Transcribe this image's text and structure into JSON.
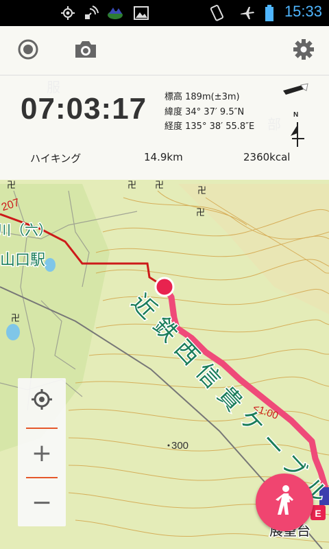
{
  "status_bar": {
    "time": "15:33",
    "icons": [
      "gps-icon",
      "satellite-icon",
      "app-icon",
      "image-icon",
      "vibrate-icon",
      "airplane-icon",
      "battery-icon"
    ]
  },
  "toolbar": {
    "record_icon": "record-icon",
    "camera_icon": "camera-icon",
    "settings_icon": "gear-icon"
  },
  "tracking": {
    "elapsed": "07:03:17",
    "elevation": "標高 189m(±3m)",
    "latitude": "緯度 34° 37′ 9.5″N",
    "longitude": "経度 135° 38′ 55.8″E",
    "compass_label": "N",
    "activity": "ハイキング",
    "distance": "14.9km",
    "calories": "2360kcal"
  },
  "map": {
    "labels": {
      "station": "山口駅",
      "railway": "近鉄西信貴ケーブル",
      "elevation_mark": "300",
      "time_marker": "<1:00",
      "viewpoint": "展望台",
      "road": "207",
      "kanji_top": "服",
      "kanji_right": "部",
      "paren": "川（六）"
    },
    "colors": {
      "track": "#ef4a79",
      "past_route": "#cc1a1a",
      "position": "#e8234f",
      "contour": "#d09a3a",
      "land": "#e4ecb8"
    }
  },
  "zoom": {
    "locate_icon": "crosshair-icon",
    "zoom_in": "+",
    "zoom_out": "−"
  },
  "fab": {
    "icon": "walking-person-icon"
  }
}
